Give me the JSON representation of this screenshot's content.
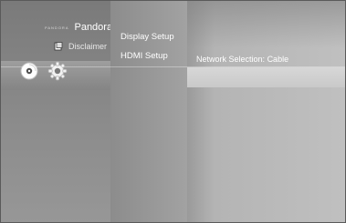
{
  "left_menu": {
    "pandora": {
      "logo_text": "PANDORA",
      "label": "Pandora"
    },
    "disclaimer": {
      "label": "Disclaimer"
    },
    "icons": {
      "disc": "disc-icon",
      "settings": "gear-icon",
      "document": "document-icon"
    }
  },
  "settings_menu": {
    "items": [
      {
        "label": "Display Setup"
      },
      {
        "label": "HDMI Setup"
      }
    ]
  },
  "detail": {
    "network_label": "Network Selection",
    "network_sep": ": ",
    "network_value": "Cable"
  }
}
